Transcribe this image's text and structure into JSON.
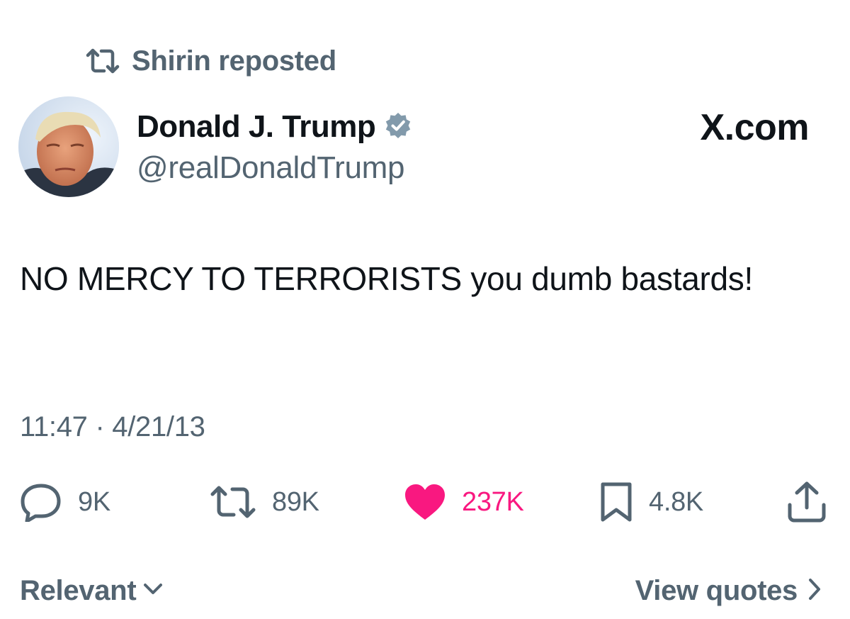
{
  "repost": {
    "label": "Shirin reposted",
    "icon": "repost-icon"
  },
  "author": {
    "name": "Donald J. Trump",
    "handle": "@realDonaldTrump",
    "verified_icon": "verified-badge-icon",
    "verified_color": "#829aab",
    "avatar": "avatar"
  },
  "source": {
    "label": "X.com"
  },
  "post": {
    "text": "NO MERCY TO TERRORISTS you dumb bastards!",
    "timestamp": "11:47 · 4/21/13"
  },
  "actions": {
    "replies": {
      "icon": "reply-icon",
      "count": "9K"
    },
    "reposts": {
      "icon": "repost-icon",
      "count": "89K"
    },
    "likes": {
      "icon": "heart-icon",
      "count": "237K",
      "liked": true
    },
    "bookmarks": {
      "icon": "bookmark-icon",
      "count": "4.8K"
    },
    "share": {
      "icon": "share-icon"
    }
  },
  "footer": {
    "sort_label": "Relevant",
    "view_quotes_label": "View quotes"
  },
  "colors": {
    "text_primary": "#0f1419",
    "text_secondary": "#536471",
    "like": "#f91880",
    "background": "#ffffff"
  }
}
